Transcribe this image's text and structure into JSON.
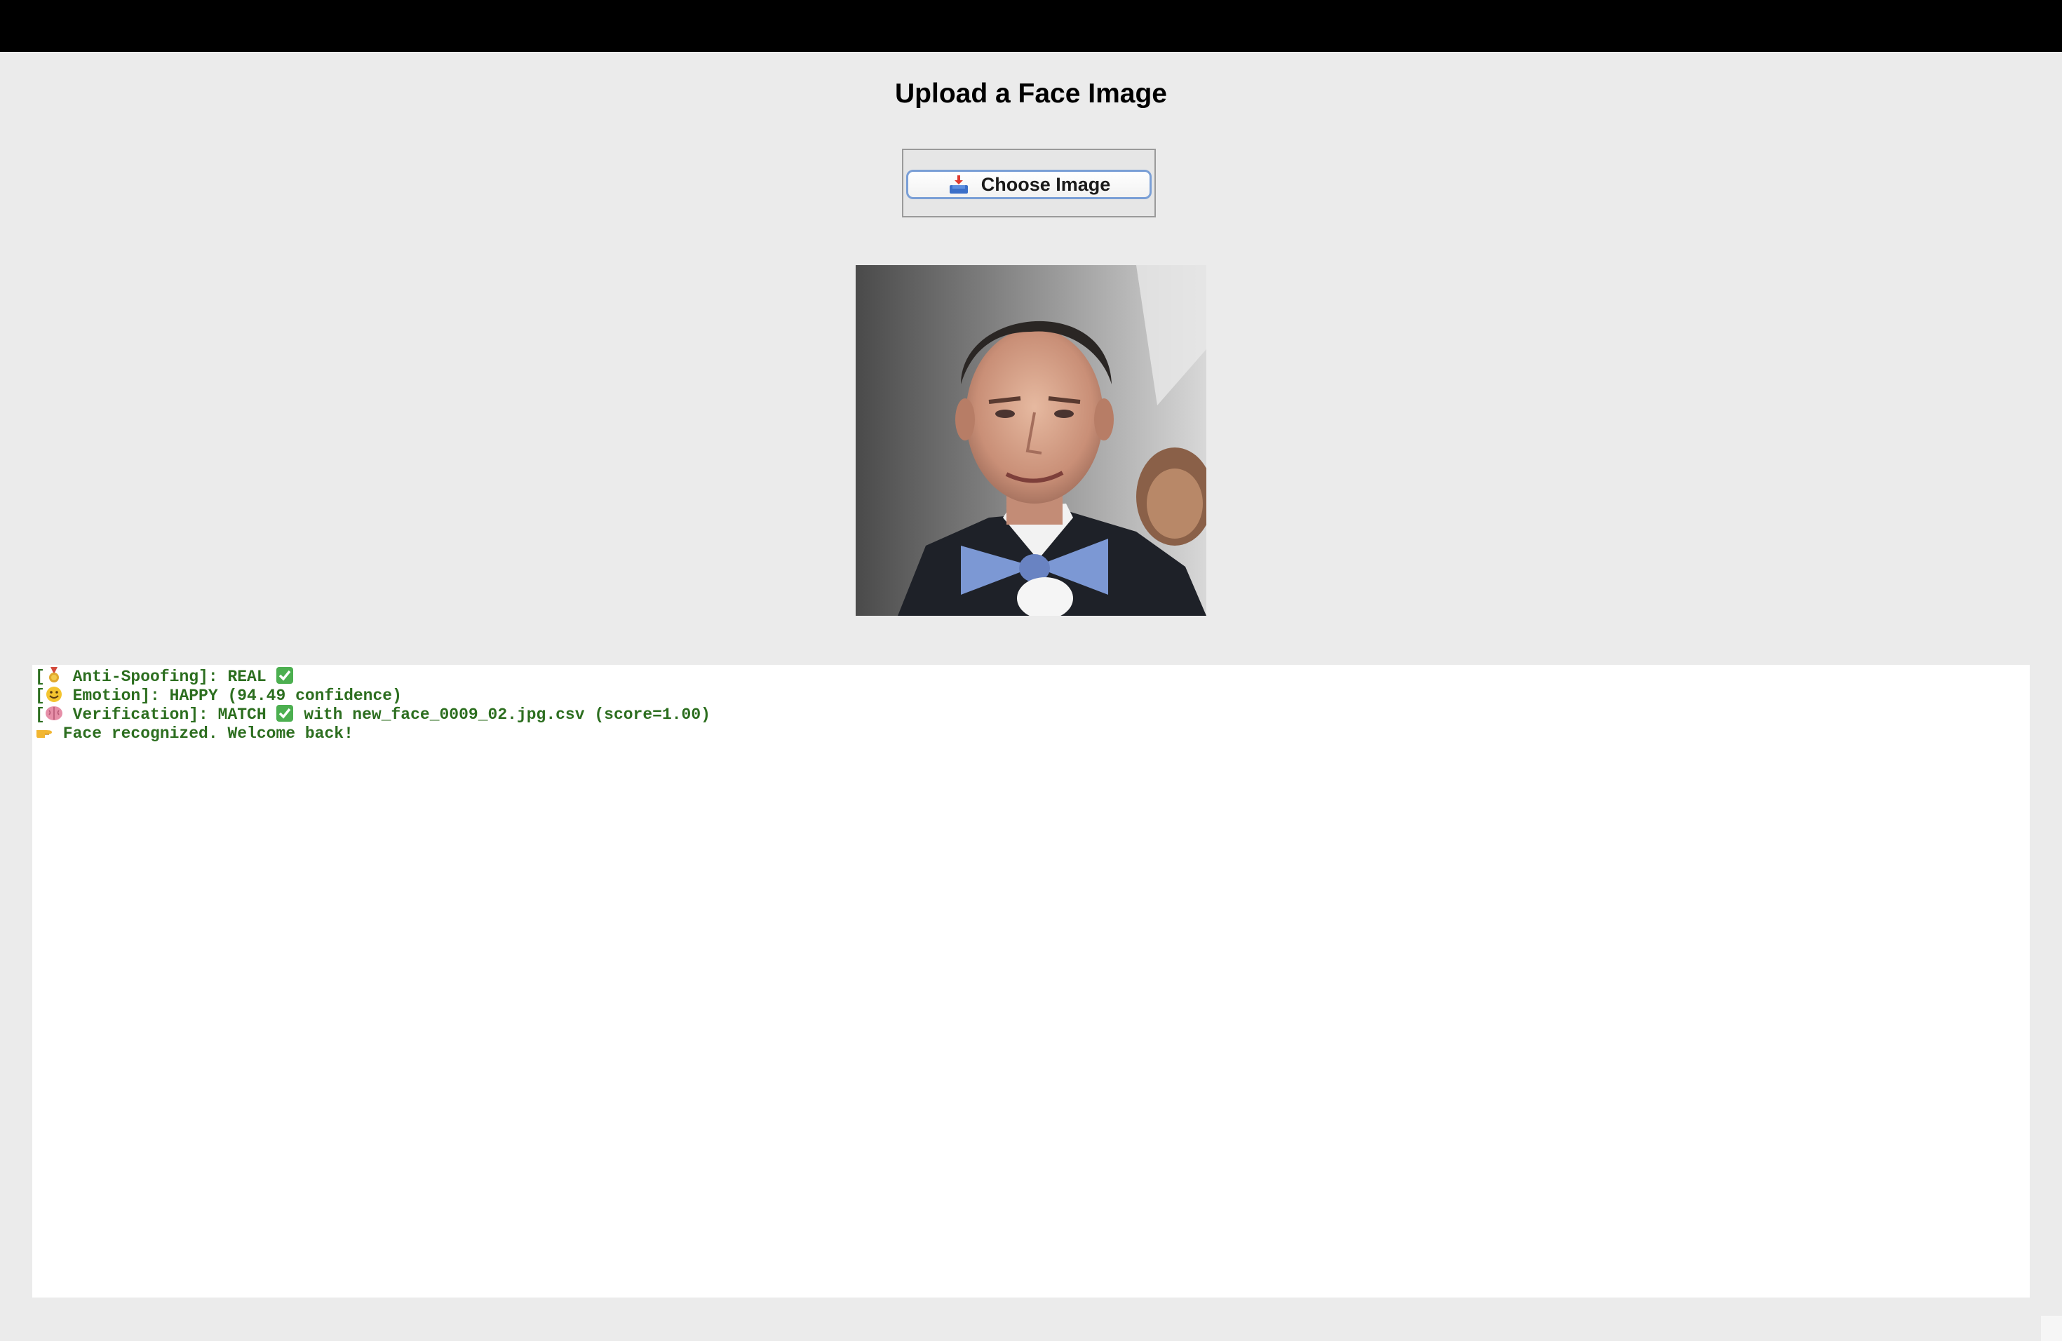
{
  "window": {
    "heading": "Upload a Face Image"
  },
  "upload": {
    "button_label": "Choose Image",
    "button_icon": "inbox-tray-icon"
  },
  "preview": {
    "image_subject": "uploaded-face-photo"
  },
  "output": {
    "lines": [
      {
        "icon": "medal-icon",
        "prefix": "[",
        "text": " Anti-Spoofing]: REAL ",
        "suffix_icon": "check-icon",
        "suffix": ""
      },
      {
        "icon": "smile-icon",
        "prefix": "[",
        "text": " Emotion]: HAPPY (94.49 confidence)",
        "suffix_icon": "",
        "suffix": ""
      },
      {
        "icon": "brain-icon",
        "prefix": "[",
        "text": " Verification]: MATCH ",
        "suffix_icon": "check-icon",
        "suffix": " with new_face_0009_02.jpg.csv (score=1.00)"
      },
      {
        "icon": "pointing-hand-icon",
        "prefix": "",
        "text": " Face recognized. Welcome back!",
        "suffix_icon": "",
        "suffix": ""
      }
    ],
    "text_color": "#2c6e1f"
  }
}
